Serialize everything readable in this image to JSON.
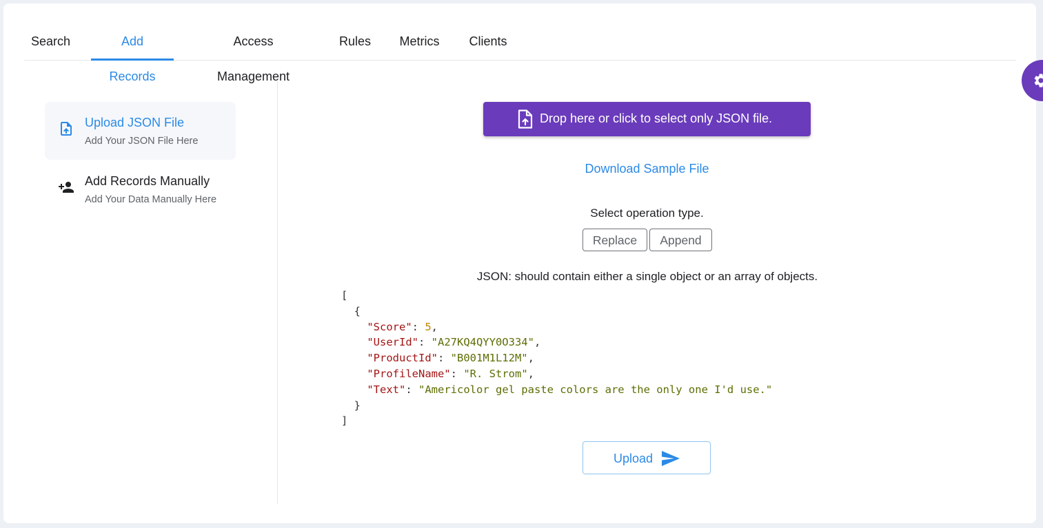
{
  "tabs": [
    {
      "label": "Search"
    },
    {
      "label": "Add Records",
      "active": true
    },
    {
      "label": "Access Management"
    },
    {
      "label": "Rules"
    },
    {
      "label": "Metrics"
    },
    {
      "label": "Clients"
    }
  ],
  "sidebar": {
    "items": [
      {
        "title": "Upload JSON File",
        "subtitle": "Add Your JSON File Here",
        "icon": "file-upload-icon",
        "active": true
      },
      {
        "title": "Add Records Manually",
        "subtitle": "Add Your Data Manually Here",
        "icon": "person-add-icon"
      }
    ]
  },
  "upload": {
    "drop_label": "Drop here or click to select only JSON file.",
    "drop_icon": "file-upload-icon",
    "sample_link": "Download Sample File",
    "operation_label": "Select operation type.",
    "operations": [
      "Replace",
      "Append"
    ],
    "json_hint": "JSON: should contain either a single object or an array of objects.",
    "sample_json": {
      "open_bracket": "[",
      "open_brace": "{",
      "fields": [
        {
          "key": "\"Score\"",
          "value": "5",
          "type": "number"
        },
        {
          "key": "\"UserId\"",
          "value": "\"A27KQ4QYY0O334\"",
          "type": "string"
        },
        {
          "key": "\"ProductId\"",
          "value": "\"B001M1L12M\"",
          "type": "string"
        },
        {
          "key": "\"ProfileName\"",
          "value": "\"R. Strom\"",
          "type": "string"
        },
        {
          "key": "\"Text\"",
          "value": "\"Americolor gel paste colors are the only one I'd use.\"",
          "type": "string"
        }
      ],
      "close_brace": "}",
      "close_bracket": "]"
    },
    "submit_label": "Upload",
    "submit_icon": "send-icon"
  },
  "settings_fab": {
    "icon": "gear-icon"
  },
  "colors": {
    "accent": "#2b8ae6",
    "primary": "#6a3bbb",
    "json_key": "#a31515",
    "json_string": "#5e6d03",
    "json_number": "#c18401"
  }
}
